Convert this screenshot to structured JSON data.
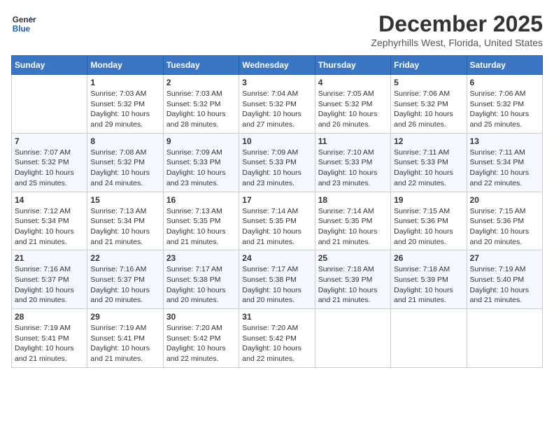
{
  "header": {
    "logo_line1": "General",
    "logo_line2": "Blue",
    "month_title": "December 2025",
    "location": "Zephyrhills West, Florida, United States"
  },
  "weekdays": [
    "Sunday",
    "Monday",
    "Tuesday",
    "Wednesday",
    "Thursday",
    "Friday",
    "Saturday"
  ],
  "weeks": [
    [
      {
        "day": "",
        "info": ""
      },
      {
        "day": "1",
        "info": "Sunrise: 7:03 AM\nSunset: 5:32 PM\nDaylight: 10 hours\nand 29 minutes."
      },
      {
        "day": "2",
        "info": "Sunrise: 7:03 AM\nSunset: 5:32 PM\nDaylight: 10 hours\nand 28 minutes."
      },
      {
        "day": "3",
        "info": "Sunrise: 7:04 AM\nSunset: 5:32 PM\nDaylight: 10 hours\nand 27 minutes."
      },
      {
        "day": "4",
        "info": "Sunrise: 7:05 AM\nSunset: 5:32 PM\nDaylight: 10 hours\nand 26 minutes."
      },
      {
        "day": "5",
        "info": "Sunrise: 7:06 AM\nSunset: 5:32 PM\nDaylight: 10 hours\nand 26 minutes."
      },
      {
        "day": "6",
        "info": "Sunrise: 7:06 AM\nSunset: 5:32 PM\nDaylight: 10 hours\nand 25 minutes."
      }
    ],
    [
      {
        "day": "7",
        "info": "Sunrise: 7:07 AM\nSunset: 5:32 PM\nDaylight: 10 hours\nand 25 minutes."
      },
      {
        "day": "8",
        "info": "Sunrise: 7:08 AM\nSunset: 5:32 PM\nDaylight: 10 hours\nand 24 minutes."
      },
      {
        "day": "9",
        "info": "Sunrise: 7:09 AM\nSunset: 5:33 PM\nDaylight: 10 hours\nand 23 minutes."
      },
      {
        "day": "10",
        "info": "Sunrise: 7:09 AM\nSunset: 5:33 PM\nDaylight: 10 hours\nand 23 minutes."
      },
      {
        "day": "11",
        "info": "Sunrise: 7:10 AM\nSunset: 5:33 PM\nDaylight: 10 hours\nand 23 minutes."
      },
      {
        "day": "12",
        "info": "Sunrise: 7:11 AM\nSunset: 5:33 PM\nDaylight: 10 hours\nand 22 minutes."
      },
      {
        "day": "13",
        "info": "Sunrise: 7:11 AM\nSunset: 5:34 PM\nDaylight: 10 hours\nand 22 minutes."
      }
    ],
    [
      {
        "day": "14",
        "info": "Sunrise: 7:12 AM\nSunset: 5:34 PM\nDaylight: 10 hours\nand 21 minutes."
      },
      {
        "day": "15",
        "info": "Sunrise: 7:13 AM\nSunset: 5:34 PM\nDaylight: 10 hours\nand 21 minutes."
      },
      {
        "day": "16",
        "info": "Sunrise: 7:13 AM\nSunset: 5:35 PM\nDaylight: 10 hours\nand 21 minutes."
      },
      {
        "day": "17",
        "info": "Sunrise: 7:14 AM\nSunset: 5:35 PM\nDaylight: 10 hours\nand 21 minutes."
      },
      {
        "day": "18",
        "info": "Sunrise: 7:14 AM\nSunset: 5:35 PM\nDaylight: 10 hours\nand 21 minutes."
      },
      {
        "day": "19",
        "info": "Sunrise: 7:15 AM\nSunset: 5:36 PM\nDaylight: 10 hours\nand 20 minutes."
      },
      {
        "day": "20",
        "info": "Sunrise: 7:15 AM\nSunset: 5:36 PM\nDaylight: 10 hours\nand 20 minutes."
      }
    ],
    [
      {
        "day": "21",
        "info": "Sunrise: 7:16 AM\nSunset: 5:37 PM\nDaylight: 10 hours\nand 20 minutes."
      },
      {
        "day": "22",
        "info": "Sunrise: 7:16 AM\nSunset: 5:37 PM\nDaylight: 10 hours\nand 20 minutes."
      },
      {
        "day": "23",
        "info": "Sunrise: 7:17 AM\nSunset: 5:38 PM\nDaylight: 10 hours\nand 20 minutes."
      },
      {
        "day": "24",
        "info": "Sunrise: 7:17 AM\nSunset: 5:38 PM\nDaylight: 10 hours\nand 20 minutes."
      },
      {
        "day": "25",
        "info": "Sunrise: 7:18 AM\nSunset: 5:39 PM\nDaylight: 10 hours\nand 21 minutes."
      },
      {
        "day": "26",
        "info": "Sunrise: 7:18 AM\nSunset: 5:39 PM\nDaylight: 10 hours\nand 21 minutes."
      },
      {
        "day": "27",
        "info": "Sunrise: 7:19 AM\nSunset: 5:40 PM\nDaylight: 10 hours\nand 21 minutes."
      }
    ],
    [
      {
        "day": "28",
        "info": "Sunrise: 7:19 AM\nSunset: 5:41 PM\nDaylight: 10 hours\nand 21 minutes."
      },
      {
        "day": "29",
        "info": "Sunrise: 7:19 AM\nSunset: 5:41 PM\nDaylight: 10 hours\nand 21 minutes."
      },
      {
        "day": "30",
        "info": "Sunrise: 7:20 AM\nSunset: 5:42 PM\nDaylight: 10 hours\nand 22 minutes."
      },
      {
        "day": "31",
        "info": "Sunrise: 7:20 AM\nSunset: 5:42 PM\nDaylight: 10 hours\nand 22 minutes."
      },
      {
        "day": "",
        "info": ""
      },
      {
        "day": "",
        "info": ""
      },
      {
        "day": "",
        "info": ""
      }
    ]
  ]
}
